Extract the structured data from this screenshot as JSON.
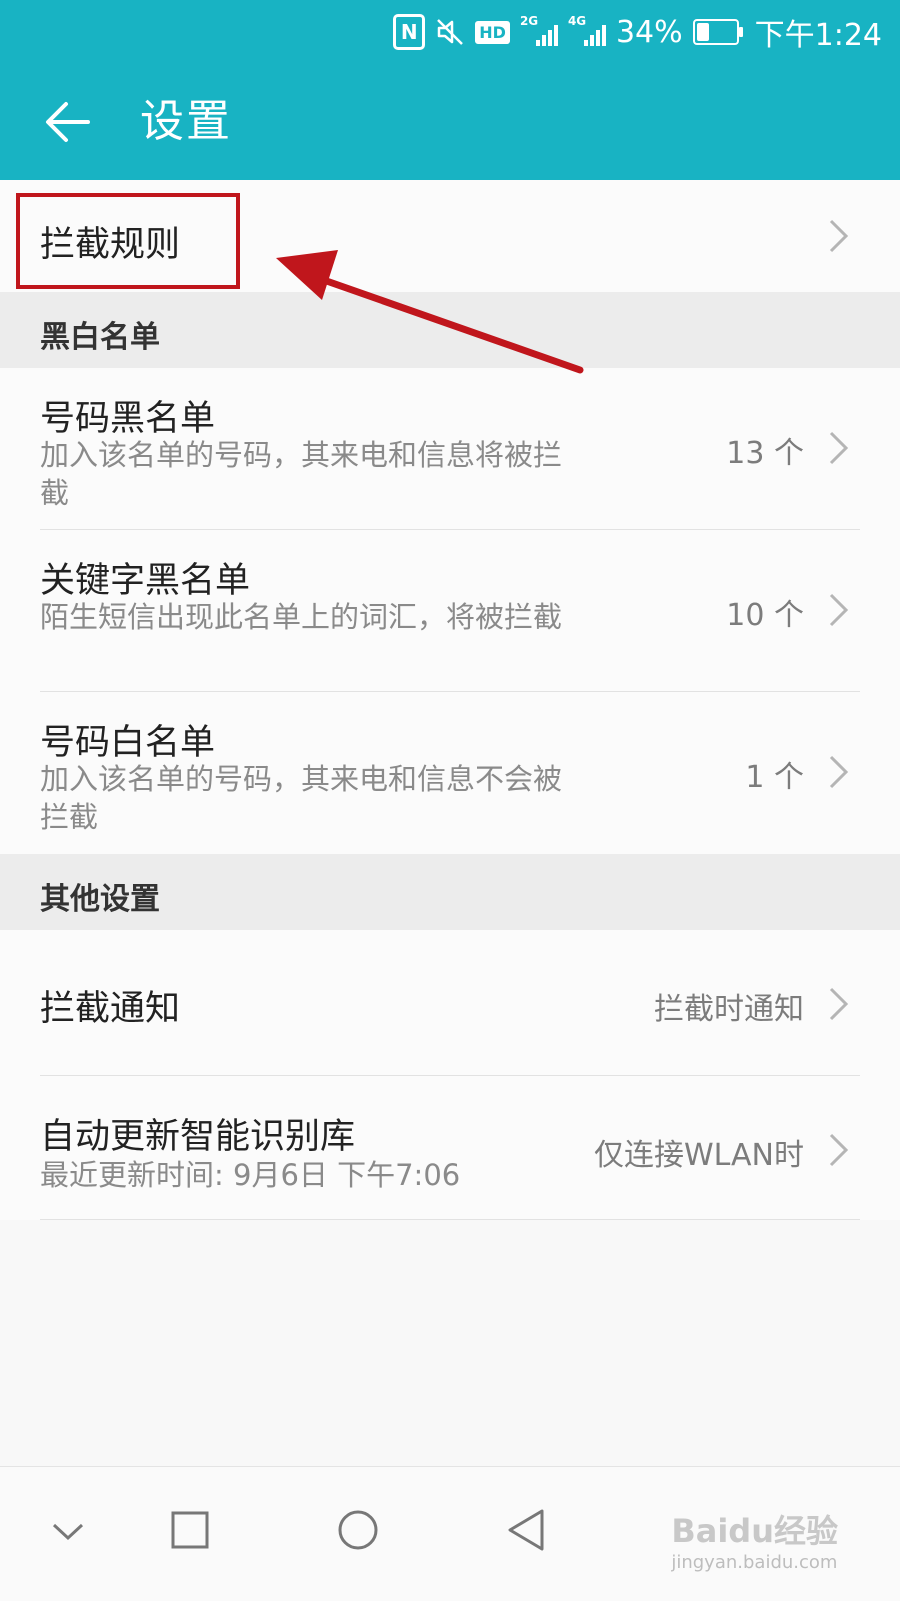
{
  "status_bar": {
    "nfc_label": "N",
    "hd_label": "HD",
    "sim1_tag": "2G",
    "sim2_tag": "4G",
    "battery_text": "34%",
    "battery_level": 0.34,
    "time": "下午1:24"
  },
  "header": {
    "title": "设置",
    "background_color": "#18b3c3"
  },
  "rows": {
    "intercept_rules": {
      "title": "拦截规则"
    },
    "blacklist_section": "黑白名单",
    "number_blacklist": {
      "title": "号码黑名单",
      "subtitle": "加入该名单的号码，其来电和信息将被拦截",
      "value": "13 个"
    },
    "keyword_blacklist": {
      "title": "关键字黑名单",
      "subtitle": "陌生短信出现此名单上的词汇，将被拦截",
      "value": "10 个"
    },
    "number_whitelist": {
      "title": "号码白名单",
      "subtitle": "加入该名单的号码，其来电和信息不会被拦截",
      "value": "1 个"
    },
    "other_section": "其他设置",
    "intercept_notify": {
      "title": "拦截通知",
      "value": "拦截时通知"
    },
    "auto_update": {
      "title": "自动更新智能识别库",
      "subtitle": "最近更新时间: 9月6日 下午7:06",
      "value": "仅连接WLAN时"
    }
  },
  "annotation": {
    "color": "#c0161c"
  },
  "watermark": {
    "brand": "Baidu经验",
    "url": "jingyan.baidu.com"
  },
  "icons": [
    "back-arrow-icon",
    "chevron-right-icon",
    "mute-icon",
    "signal-icon",
    "battery-icon",
    "nav-collapse-icon",
    "nav-recents-icon",
    "nav-home-icon",
    "nav-back-icon"
  ]
}
